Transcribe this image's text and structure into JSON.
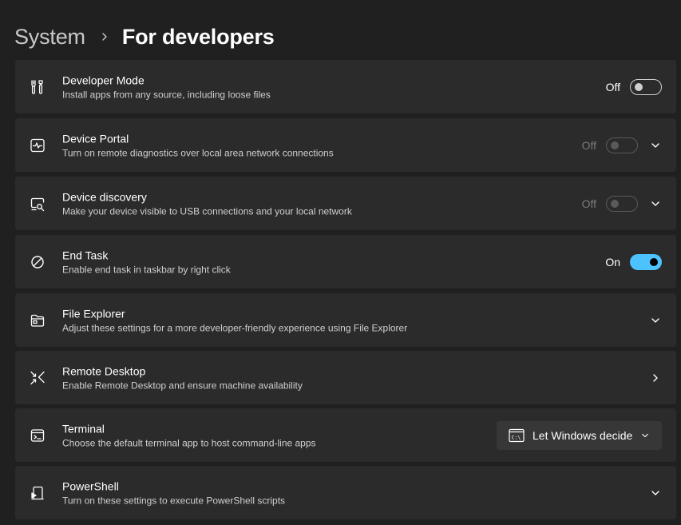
{
  "breadcrumb": {
    "parent": "System",
    "separator_icon": "chevron-right-icon",
    "current": "For developers"
  },
  "settings": [
    {
      "id": "developer-mode",
      "icon": "developer-tools-icon",
      "title": "Developer Mode",
      "description": "Install apps from any source, including loose files",
      "state_label": "Off",
      "toggle_on": false,
      "disabled": false
    },
    {
      "id": "device-portal",
      "icon": "device-portal-icon",
      "title": "Device Portal",
      "description": "Turn on remote diagnostics over local area network connections",
      "state_label": "Off",
      "toggle_on": false,
      "disabled": true,
      "expand_icon": "chevron-down-icon"
    },
    {
      "id": "device-discovery",
      "icon": "device-discovery-icon",
      "title": "Device discovery",
      "description": "Make your device visible to USB connections and your local network",
      "state_label": "Off",
      "toggle_on": false,
      "disabled": true,
      "expand_icon": "chevron-down-icon"
    },
    {
      "id": "end-task",
      "icon": "block-icon",
      "title": "End Task",
      "description": "Enable end task in taskbar by right click",
      "state_label": "On",
      "toggle_on": true,
      "disabled": false
    },
    {
      "id": "file-explorer",
      "icon": "folder-icon",
      "title": "File Explorer",
      "description": "Adjust these settings for a more developer-friendly experience using File Explorer",
      "expand_icon": "chevron-down-icon"
    },
    {
      "id": "remote-desktop",
      "icon": "remote-desktop-icon",
      "title": "Remote Desktop",
      "description": "Enable Remote Desktop and ensure machine availability",
      "nav_icon": "chevron-right-icon"
    },
    {
      "id": "terminal",
      "icon": "terminal-icon",
      "title": "Terminal",
      "description": "Choose the default terminal app to host command-line apps",
      "dropdown": {
        "icon": "console-icon",
        "selected": "Let Windows decide",
        "chevron_icon": "chevron-down-icon"
      }
    },
    {
      "id": "powershell",
      "icon": "powershell-icon",
      "title": "PowerShell",
      "description": "Turn on these settings to execute PowerShell scripts",
      "expand_icon": "chevron-down-icon"
    }
  ],
  "colors": {
    "background": "#202020",
    "card": "#2b2b2b",
    "accent": "#4cc2ff",
    "text_secondary": "#cfcfcf",
    "text_disabled": "#7a7a7a"
  }
}
